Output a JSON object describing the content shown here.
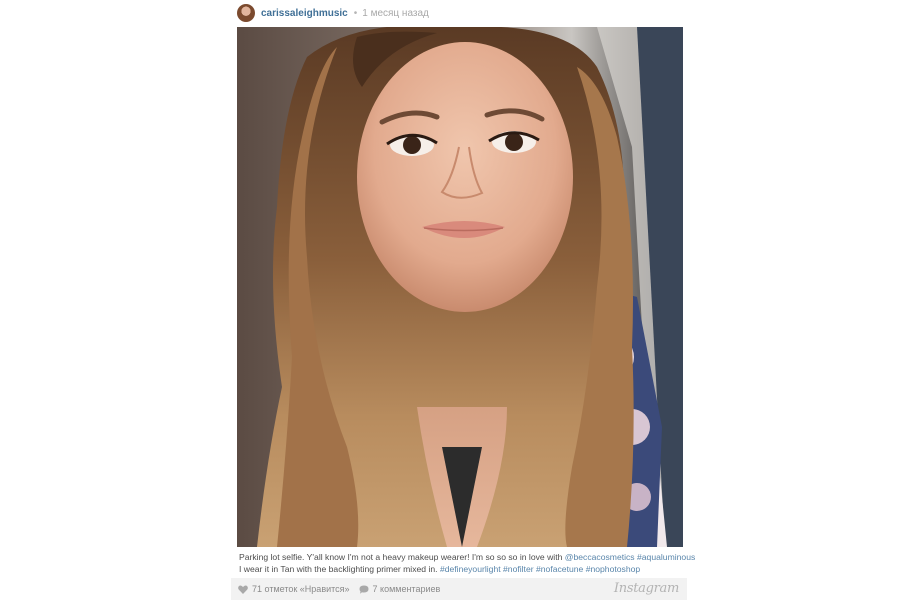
{
  "post": {
    "username": "carissaleighmusic",
    "separator": "•",
    "timestamp": "1 месяц назад"
  },
  "photo": {
    "description": "selfie photograph"
  },
  "caption": {
    "line1_text": "Parking lot selfie. Y'all know I'm not a heavy makeup wearer! I'm so so so in love with ",
    "line1_mention": "@beccacosmetics",
    "line1_hashtag": "#aqualuminous",
    "line2_text": "I wear it in Tan with the backlighting primer mixed in. ",
    "hashtags": [
      "#defineyourlight",
      "#nofilter",
      "#nofacetune",
      "#nophotoshop"
    ]
  },
  "footer": {
    "likes": "71 отметок «Нравится»",
    "comments": "7 комментариев",
    "logo": "Instagram"
  },
  "colors": {
    "link": "#3f6f96",
    "hashtag": "#5a86ab",
    "footer_bg": "#f2f2f2"
  }
}
